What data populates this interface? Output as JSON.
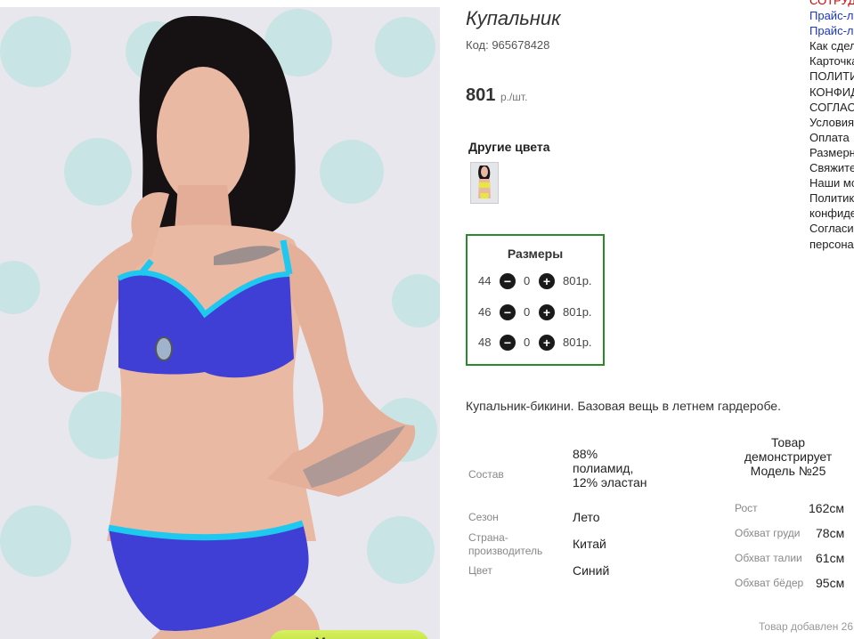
{
  "product": {
    "title": "Купальник",
    "code": "Код: 965678428",
    "price": "801",
    "price_unit": "р./шт.",
    "zoom_label": "+ Увеличить"
  },
  "other_colors": {
    "title": "Другие цвета"
  },
  "sizes": {
    "title": "Размеры",
    "rows": [
      {
        "size": "44",
        "minus": "−",
        "qty": "0",
        "plus": "+",
        "price": "801р."
      },
      {
        "size": "46",
        "minus": "−",
        "qty": "0",
        "plus": "+",
        "price": "801р."
      },
      {
        "size": "48",
        "minus": "−",
        "qty": "0",
        "plus": "+",
        "price": "801р."
      }
    ]
  },
  "description": "Купальник-бикини. Базовая вещь в летнем гардеробе.",
  "properties": [
    {
      "label": "Состав",
      "value": "88% полиамид, 12% эластан"
    },
    {
      "label": "Сезон",
      "value": "Лето"
    },
    {
      "label": "Страна-производитель",
      "value": "Китай"
    },
    {
      "label": "Цвет",
      "value": "Синий"
    }
  ],
  "model": {
    "title": "Товар демонстрирует Модель №25",
    "params": [
      {
        "label": "Рост",
        "value": "162см"
      },
      {
        "label": "Обхват груди",
        "value": "78см"
      },
      {
        "label": "Обхват талии",
        "value": "61см"
      },
      {
        "label": "Обхват бёдер",
        "value": "95см"
      }
    ]
  },
  "added_text": "Товар добавлен 26",
  "side_links": [
    {
      "text": "СОТРУДНИЧЕСТВО",
      "color": "#d40000"
    },
    {
      "text": "Прайс-лист",
      "color": "#1a35c8"
    },
    {
      "text": "Прайс-лист",
      "color": "#1a35c8"
    },
    {
      "text": "Как сделать заказ",
      "color": "#222222"
    },
    {
      "text": "Карточка",
      "color": "#222222"
    },
    {
      "text": "ПОЛИТИКА",
      "color": "#222222"
    },
    {
      "text": "КОНФИДЕНЦИАЛЬНОСТИ",
      "color": "#222222"
    },
    {
      "text": "СОГЛАСИЕ",
      "color": "#222222"
    },
    {
      "text": "Условия",
      "color": "#222222"
    },
    {
      "text": "Оплата",
      "color": "#222222"
    },
    {
      "text": "Размерная сетка",
      "color": "#222222"
    },
    {
      "text": "Свяжитесь с нами",
      "color": "#222222"
    },
    {
      "text": "Наши модели",
      "color": "#222222"
    },
    {
      "text": "Политика",
      "color": "#222222"
    },
    {
      "text": "конфиденциальности",
      "color": "#222222"
    },
    {
      "text": "Согласие на обработку",
      "color": "#222222"
    },
    {
      "text": "персональных данных",
      "color": "#222222"
    }
  ],
  "colors": {
    "accent_green": "#2a8a2a",
    "swimsuit_blue": "#3f3fd6",
    "trim_cyan": "#1ec8ee",
    "zoom_button": "#b8df2a"
  }
}
